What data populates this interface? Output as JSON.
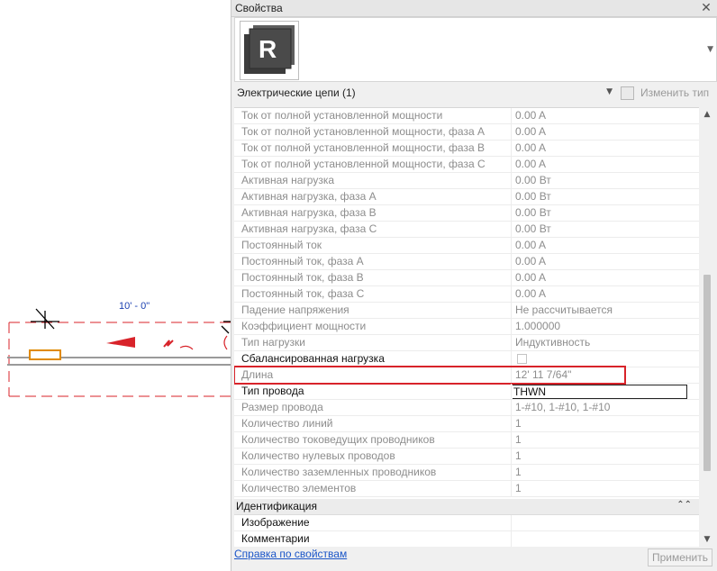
{
  "canvas": {
    "dimension_text": "10' - 0\""
  },
  "palette": {
    "title": "Свойства",
    "close_glyph": "✕",
    "type_thumbnail_letter": "R",
    "selector_label": "Электрические цепи (1)",
    "edit_type_label": "Изменить тип",
    "help_link": "Справка по свойствам",
    "apply_label": "Применить"
  },
  "properties": [
    {
      "name": "Ток от полной установленной мощности",
      "value": "0.00 A"
    },
    {
      "name": "Ток от полной установленной мощности, фаза A",
      "value": "0.00 A"
    },
    {
      "name": "Ток от полной установленной мощности, фаза B",
      "value": "0.00 A"
    },
    {
      "name": "Ток от полной установленной мощности, фаза C",
      "value": "0.00 A"
    },
    {
      "name": "Активная нагрузка",
      "value": "0.00 Вт"
    },
    {
      "name": "Активная нагрузка, фаза A",
      "value": "0.00 Вт"
    },
    {
      "name": "Активная нагрузка, фаза B",
      "value": "0.00 Вт"
    },
    {
      "name": "Активная нагрузка, фаза C",
      "value": "0.00 Вт"
    },
    {
      "name": "Постоянный ток",
      "value": "0.00 A"
    },
    {
      "name": "Постоянный ток, фаза A",
      "value": "0.00 A"
    },
    {
      "name": "Постоянный ток, фаза B",
      "value": "0.00 A"
    },
    {
      "name": "Постоянный ток, фаза C",
      "value": "0.00 A"
    },
    {
      "name": "Падение напряжения",
      "value": "Не рассчитывается"
    },
    {
      "name": "Коэффициент мощности",
      "value": "1.000000"
    },
    {
      "name": "Тип нагрузки",
      "value": "Индуктивность"
    },
    {
      "name": "Сбалансированная нагрузка",
      "value": ""
    },
    {
      "name": "Длина",
      "value": "12'  11 7/64\""
    },
    {
      "name": "Тип провода",
      "value": "THWN"
    },
    {
      "name": "Размер провода",
      "value": "1-#10, 1-#10, 1-#10"
    },
    {
      "name": "Количество линий",
      "value": "1"
    },
    {
      "name": "Количество токоведущих проводников",
      "value": "1"
    },
    {
      "name": "Количество нулевых проводов",
      "value": "1"
    },
    {
      "name": "Количество заземленных проводников",
      "value": "1"
    },
    {
      "name": "Количество элементов",
      "value": "1"
    }
  ],
  "group_identification": {
    "label": "Идентификация",
    "chevron": "⌃⌃",
    "rows": [
      {
        "name": "Изображение",
        "value": ""
      },
      {
        "name": "Комментарии",
        "value": ""
      }
    ]
  },
  "colors": {
    "highlight_border": "#d8232a",
    "link": "#1a55c8",
    "dimension_text": "#1a3fb0",
    "circuit_dash": "#d8232a",
    "device_orange": "#e08a00"
  }
}
